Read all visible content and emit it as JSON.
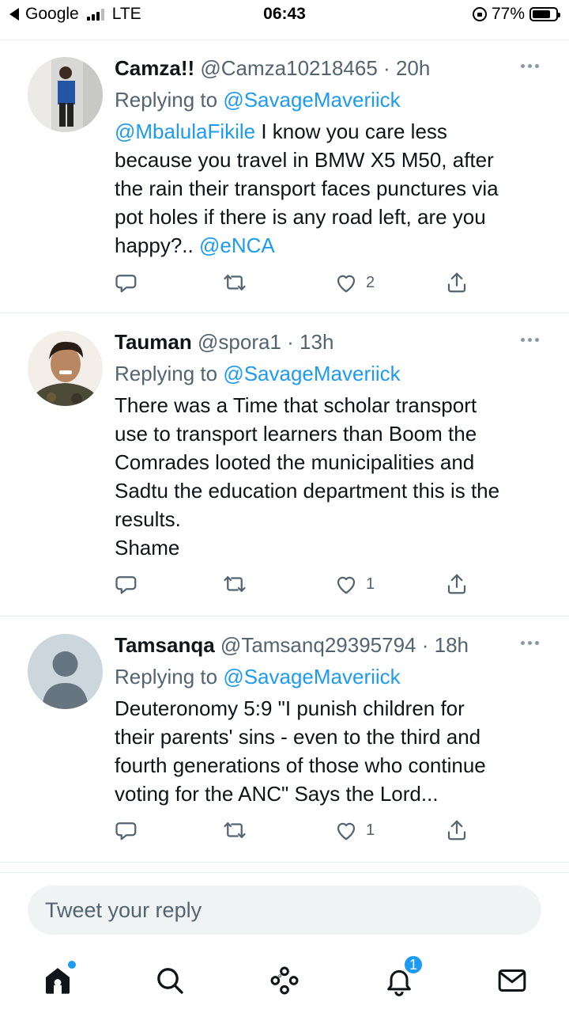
{
  "status_bar": {
    "back_app": "Google",
    "network": "LTE",
    "time": "06:43",
    "battery": "77%",
    "battery_level": 0.77
  },
  "tweets": [
    {
      "name": "Camza!!",
      "handle": "@Camza10218465",
      "time": "20h",
      "replying_label": "Replying to",
      "replying_to": "@SavageMaveriick",
      "text_mention_start": "@MbalulaFikile",
      "text": " I know you care less\nbecause you travel in BMW X5 M50, after\nthe rain their transport faces punctures via\npot holes if there is any road left, are you\nhappy?.. ",
      "text_mention_end": "@eNCA",
      "likes": "2"
    },
    {
      "name": "Tauman",
      "handle": "@spora1",
      "time": "13h",
      "replying_label": "Replying to",
      "replying_to": "@SavageMaveriick",
      "text": "There was a Time that scholar transport\nuse to transport learners than Boom the\nComrades looted the municipalities and\nSadtu the education department this is the\nresults.\nShame",
      "likes": "1"
    },
    {
      "name": "Tamsanqa",
      "handle": "@Tamsanq29395794",
      "time": "18h",
      "replying_label": "Replying to",
      "replying_to": "@SavageMaveriick",
      "text": "Deuteronomy 5:9 \"I punish children for\ntheir parents' sins - even to the third and\nfourth generations of those who continue\nvoting for the ANC\" Says the Lord...",
      "likes": "1"
    }
  ],
  "reply_box": {
    "placeholder": "Tweet your reply"
  },
  "bottom_nav": {
    "items": [
      "home-icon",
      "search-icon",
      "spaces-icon",
      "notifications-icon",
      "messages-icon"
    ],
    "notification_count": "1"
  },
  "colors": {
    "accent": "#1d9bf0",
    "secondary_text": "#536471",
    "primary_text": "#0f1419"
  }
}
